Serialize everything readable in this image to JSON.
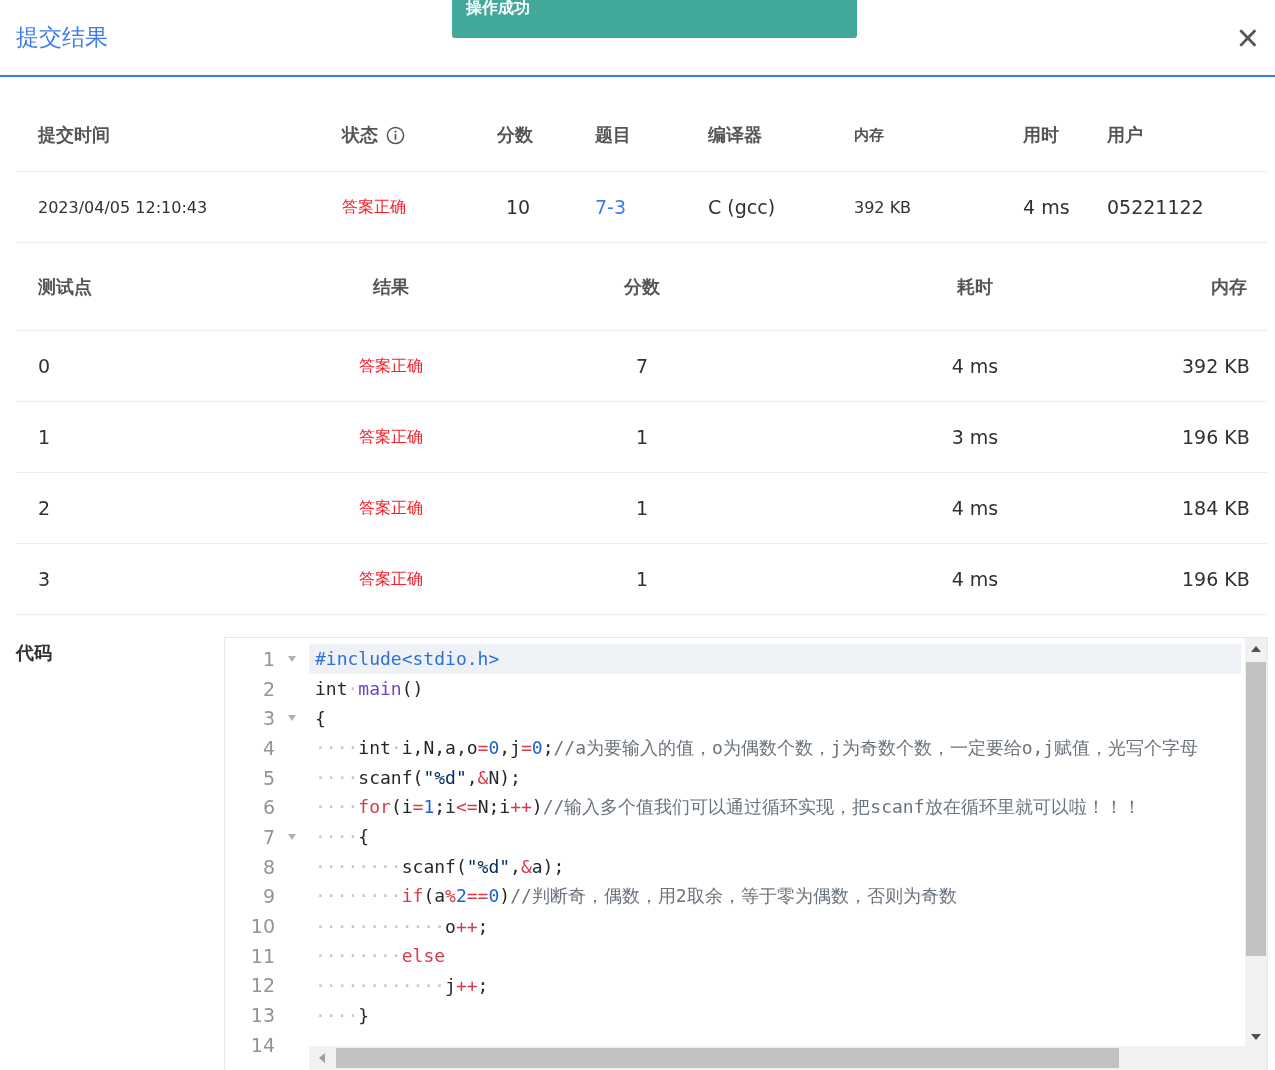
{
  "dialog": {
    "title": "提交结果",
    "close": "×"
  },
  "toast": {
    "message": "操作成功"
  },
  "summary": {
    "columns": [
      "提交时间",
      "状态",
      "分数",
      "题目",
      "编译器",
      "内存",
      "用时",
      "用户"
    ],
    "row": {
      "time": "2023/04/05 12:10:43",
      "status": {
        "text": "答案正确",
        "kind": "accepted"
      },
      "score": "10",
      "problem": "7-3",
      "compiler": "C (gcc)",
      "memory": "392 KB",
      "duration": "4 ms",
      "user": "05221122"
    }
  },
  "cases": {
    "columns": [
      "测试点",
      "结果",
      "分数",
      "耗时",
      "内存"
    ],
    "rows": [
      {
        "id": "0",
        "result": {
          "text": "答案正确",
          "kind": "accepted"
        },
        "score": "7",
        "time": "4 ms",
        "memory": "392 KB"
      },
      {
        "id": "1",
        "result": {
          "text": "答案正确",
          "kind": "accepted"
        },
        "score": "1",
        "time": "3 ms",
        "memory": "196 KB"
      },
      {
        "id": "2",
        "result": {
          "text": "答案正确",
          "kind": "accepted"
        },
        "score": "1",
        "time": "4 ms",
        "memory": "184 KB"
      },
      {
        "id": "3",
        "result": {
          "text": "答案正确",
          "kind": "accepted"
        },
        "score": "1",
        "time": "4 ms",
        "memory": "196 KB"
      }
    ]
  },
  "code": {
    "label": "代码",
    "lines": [
      {
        "number": "1",
        "fold": true,
        "selected": true,
        "tokens": [
          {
            "t": "#include<stdio.h>",
            "kind": "include"
          }
        ]
      },
      {
        "number": "2",
        "fold": false,
        "selected": false,
        "tokens": [
          {
            "t": "int",
            "kind": "plain"
          },
          {
            "t": "·",
            "kind": "ws"
          },
          {
            "t": "main",
            "kind": "fn"
          },
          {
            "t": "()",
            "kind": "plain"
          }
        ]
      },
      {
        "number": "3",
        "fold": true,
        "selected": false,
        "tokens": [
          {
            "t": "{",
            "kind": "plain"
          }
        ]
      },
      {
        "number": "4",
        "fold": false,
        "selected": false,
        "tokens": [
          {
            "t": "····",
            "kind": "ws"
          },
          {
            "t": "int",
            "kind": "plain"
          },
          {
            "t": "·",
            "kind": "ws"
          },
          {
            "t": "i,N,a,o",
            "kind": "plain"
          },
          {
            "t": "=",
            "kind": "op"
          },
          {
            "t": "0",
            "kind": "num"
          },
          {
            "t": ",j",
            "kind": "plain"
          },
          {
            "t": "=",
            "kind": "op"
          },
          {
            "t": "0",
            "kind": "num"
          },
          {
            "t": ";",
            "kind": "plain"
          },
          {
            "t": "//a为要输入的值，o为偶数个数，j为奇数个数，一定要给o,j赋值，光写个字母",
            "kind": "comment"
          }
        ]
      },
      {
        "number": "5",
        "fold": false,
        "selected": false,
        "tokens": [
          {
            "t": "····",
            "kind": "ws"
          },
          {
            "t": "scanf(",
            "kind": "plain"
          },
          {
            "t": "\"%d\"",
            "kind": "str"
          },
          {
            "t": ",",
            "kind": "plain"
          },
          {
            "t": "&",
            "kind": "op"
          },
          {
            "t": "N);",
            "kind": "plain"
          }
        ]
      },
      {
        "number": "6",
        "fold": false,
        "selected": false,
        "tokens": [
          {
            "t": "····",
            "kind": "ws"
          },
          {
            "t": "for",
            "kind": "kw"
          },
          {
            "t": "(i",
            "kind": "plain"
          },
          {
            "t": "=",
            "kind": "op"
          },
          {
            "t": "1",
            "kind": "num"
          },
          {
            "t": ";i",
            "kind": "plain"
          },
          {
            "t": "<=",
            "kind": "op"
          },
          {
            "t": "N;i",
            "kind": "plain"
          },
          {
            "t": "++",
            "kind": "op"
          },
          {
            "t": ")",
            "kind": "plain"
          },
          {
            "t": "//输入多个值我们可以通过循环实现，把scanf放在循环里就可以啦！！！",
            "kind": "comment"
          }
        ]
      },
      {
        "number": "7",
        "fold": true,
        "selected": false,
        "tokens": [
          {
            "t": "····",
            "kind": "ws"
          },
          {
            "t": "{",
            "kind": "plain"
          }
        ]
      },
      {
        "number": "8",
        "fold": false,
        "selected": false,
        "tokens": [
          {
            "t": "········",
            "kind": "ws"
          },
          {
            "t": "scanf(",
            "kind": "plain"
          },
          {
            "t": "\"%d\"",
            "kind": "str"
          },
          {
            "t": ",",
            "kind": "plain"
          },
          {
            "t": "&",
            "kind": "op"
          },
          {
            "t": "a);",
            "kind": "plain"
          }
        ]
      },
      {
        "number": "9",
        "fold": false,
        "selected": false,
        "tokens": [
          {
            "t": "········",
            "kind": "ws"
          },
          {
            "t": "if",
            "kind": "kw"
          },
          {
            "t": "(a",
            "kind": "plain"
          },
          {
            "t": "%",
            "kind": "op"
          },
          {
            "t": "2",
            "kind": "num"
          },
          {
            "t": "==",
            "kind": "op"
          },
          {
            "t": "0",
            "kind": "num"
          },
          {
            "t": ")",
            "kind": "plain"
          },
          {
            "t": "//判断奇，偶数，用2取余，等于零为偶数，否则为奇数",
            "kind": "comment"
          }
        ]
      },
      {
        "number": "10",
        "fold": false,
        "selected": false,
        "tokens": [
          {
            "t": "············",
            "kind": "ws"
          },
          {
            "t": "o",
            "kind": "plain"
          },
          {
            "t": "++",
            "kind": "op"
          },
          {
            "t": ";",
            "kind": "plain"
          }
        ]
      },
      {
        "number": "11",
        "fold": false,
        "selected": false,
        "tokens": [
          {
            "t": "········",
            "kind": "ws"
          },
          {
            "t": "else",
            "kind": "kw"
          }
        ]
      },
      {
        "number": "12",
        "fold": false,
        "selected": false,
        "tokens": [
          {
            "t": "············",
            "kind": "ws"
          },
          {
            "t": "j",
            "kind": "plain"
          },
          {
            "t": "++",
            "kind": "op"
          },
          {
            "t": ";",
            "kind": "plain"
          }
        ]
      },
      {
        "number": "13",
        "fold": false,
        "selected": false,
        "tokens": [
          {
            "t": "····",
            "kind": "ws"
          },
          {
            "t": "}",
            "kind": "plain"
          }
        ]
      },
      {
        "number": "14",
        "fold": false,
        "selected": false
      }
    ]
  }
}
